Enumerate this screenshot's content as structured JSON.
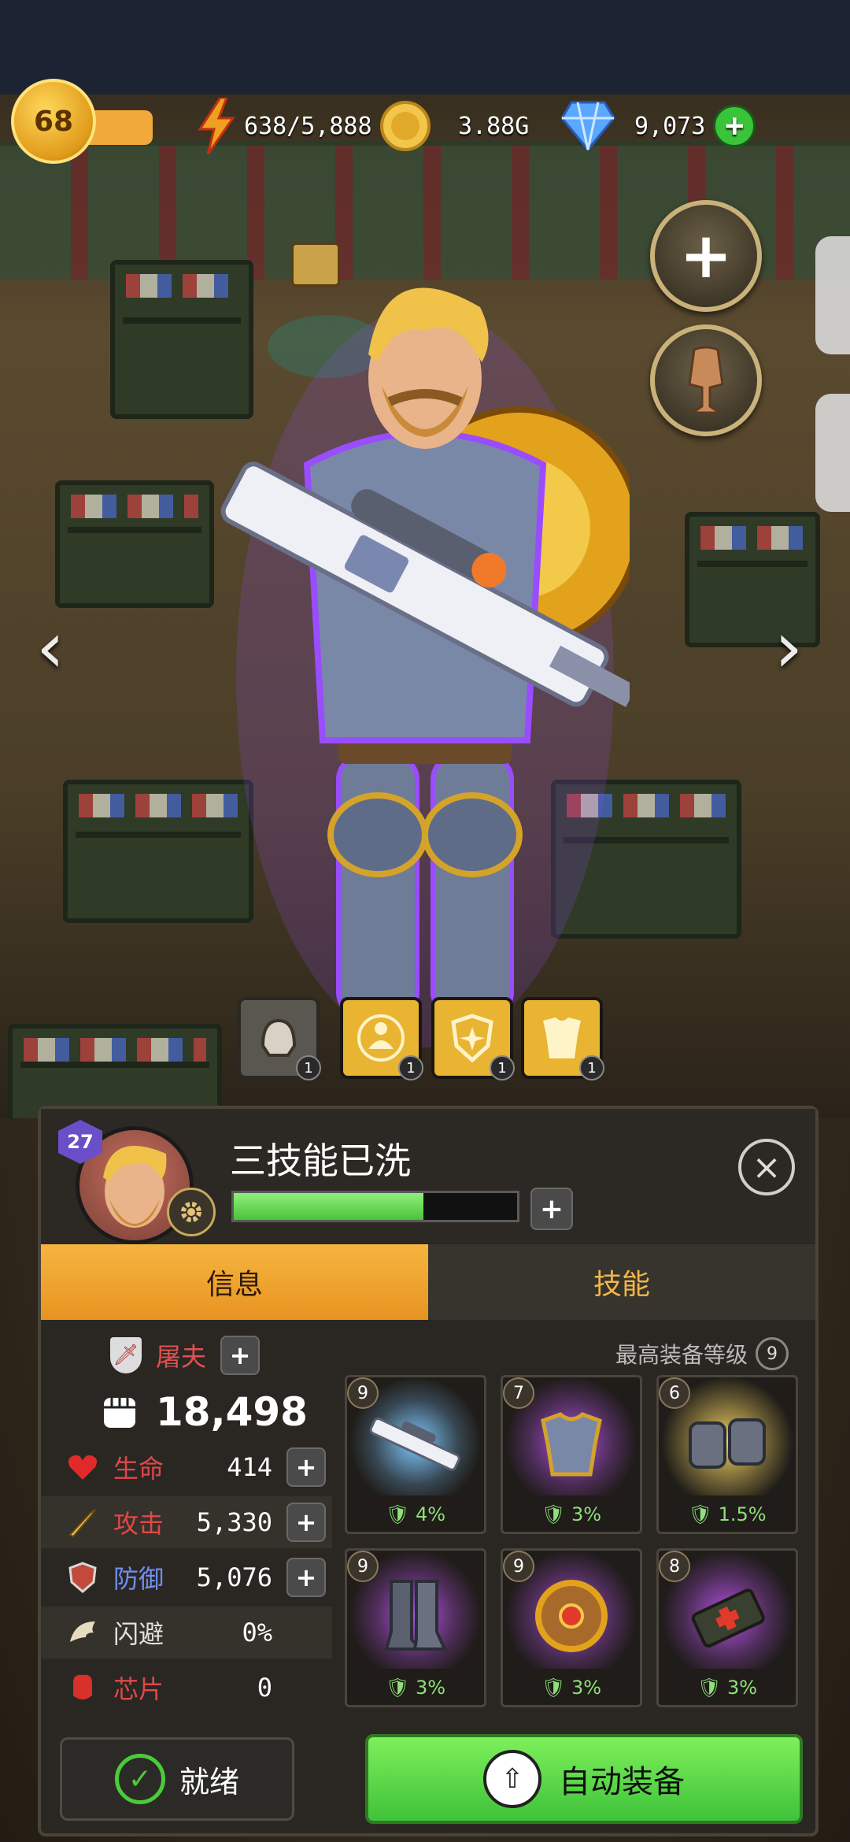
{
  "hud": {
    "player_level": "68",
    "energy": "638/5,888",
    "gold": "3.88G",
    "gems": "9,073"
  },
  "gear_slots": [
    {
      "name": "helmet-slot",
      "count": "1",
      "style": "gray"
    },
    {
      "name": "armor-slot",
      "count": "1",
      "style": "gold"
    },
    {
      "name": "shield-slot",
      "count": "1",
      "style": "gold"
    },
    {
      "name": "chest-slot",
      "count": "1",
      "style": "gold"
    }
  ],
  "hero": {
    "level": "27",
    "name": "三技能已洗",
    "xp_fraction": 0.67
  },
  "tabs": {
    "info": "信息",
    "skills": "技能"
  },
  "stats": {
    "class_label": "屠夫",
    "power": "18,498",
    "max_equip_label": "最高装备等级",
    "max_equip_level": "9",
    "rows": [
      {
        "label": "生命",
        "value": "414",
        "color": "#e04848",
        "icon": "heart-icon",
        "has_plus": true
      },
      {
        "label": "攻击",
        "value": "5,330",
        "color": "#e04848",
        "icon": "sword-icon",
        "has_plus": true
      },
      {
        "label": "防御",
        "value": "5,076",
        "color": "#6f8ff2",
        "icon": "shield-icon",
        "has_plus": true
      },
      {
        "label": "闪避",
        "value": "0%",
        "color": "#e0e0e0",
        "icon": "wing-icon",
        "has_plus": false
      },
      {
        "label": "芯片",
        "value": "0",
        "color": "#e04848",
        "icon": "chip-icon",
        "has_plus": false
      }
    ]
  },
  "equipment": [
    {
      "level": "9",
      "bonus": "4%",
      "item": "sniper-rifle",
      "glow": "#7fc8ff"
    },
    {
      "level": "7",
      "bonus": "3%",
      "item": "armor",
      "glow": "#b050e0"
    },
    {
      "level": "6",
      "bonus": "1.5%",
      "item": "gloves",
      "glow": "#f0d060"
    },
    {
      "level": "9",
      "bonus": "3%",
      "item": "boots",
      "glow": "#b050e0"
    },
    {
      "level": "9",
      "bonus": "3%",
      "item": "shield",
      "glow": "#b050e0"
    },
    {
      "level": "8",
      "bonus": "3%",
      "item": "medkit",
      "glow": "#b050e0"
    }
  ],
  "buttons": {
    "ready": "就绪",
    "auto_equip": "自动装备"
  },
  "colors": {
    "accent_orange": "#f0a030",
    "accent_green": "#4acb3a",
    "panel_bg": "#2a2723"
  }
}
